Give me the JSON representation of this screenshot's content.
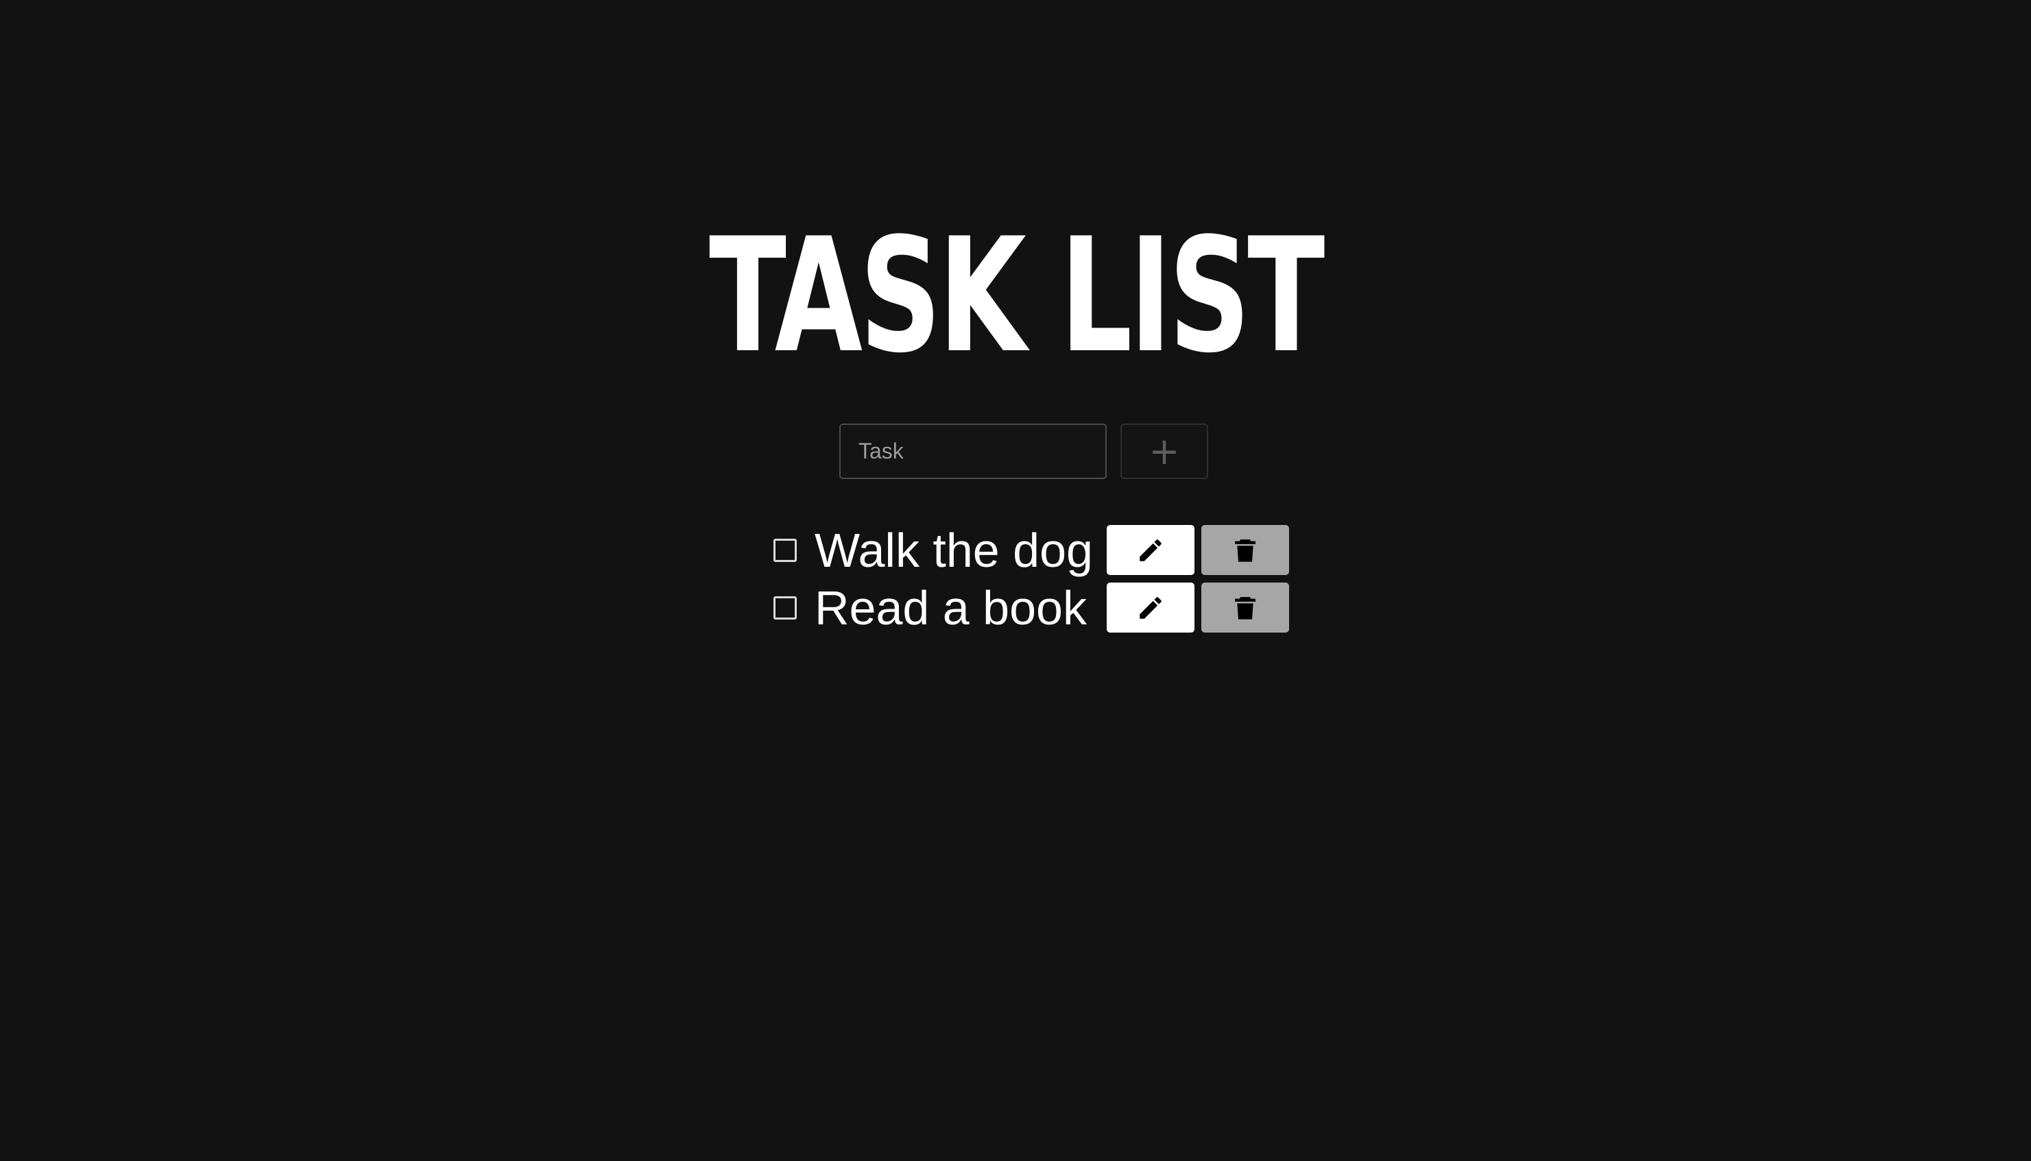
{
  "app": {
    "title": "TASK LIST"
  },
  "new_task": {
    "placeholder": "Task",
    "value": "",
    "add_button_icon": "plus-icon",
    "add_button_label": "+"
  },
  "tasks": [
    {
      "text": "Walk the dog",
      "done": false,
      "edit_icon": "pencil-icon",
      "delete_icon": "trash-icon"
    },
    {
      "text": "Read a book",
      "done": false,
      "edit_icon": "pencil-icon",
      "delete_icon": "trash-icon"
    }
  ],
  "colors": {
    "background": "#121212",
    "text": "#ffffff",
    "edit_button": "#ffffff",
    "delete_button": "#a6a6a6",
    "input_border": "#4a4a4a"
  }
}
